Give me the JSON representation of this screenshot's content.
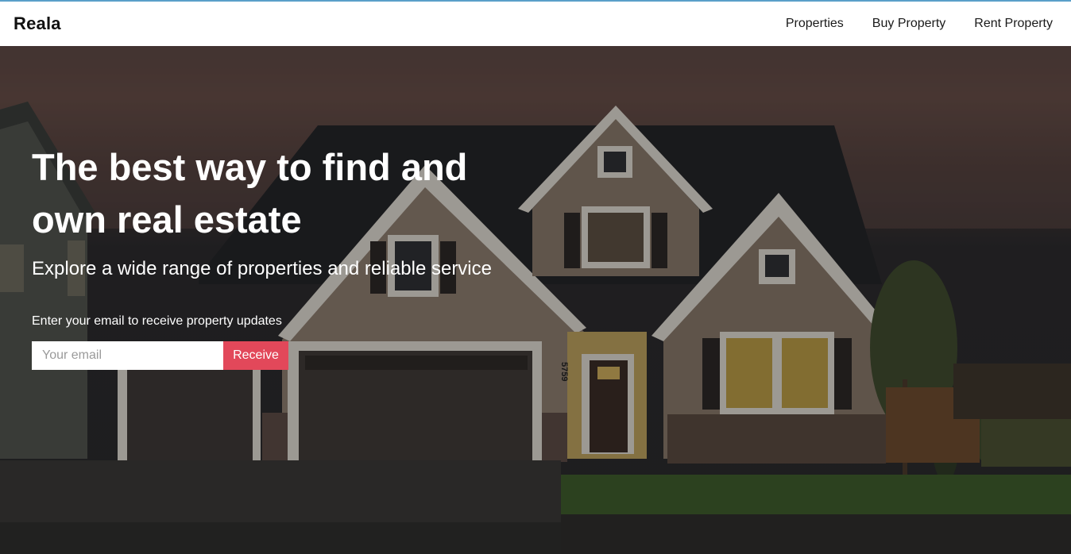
{
  "brand": "Reala",
  "nav": {
    "items": [
      {
        "label": "Properties"
      },
      {
        "label": "Buy Property"
      },
      {
        "label": "Rent Property"
      }
    ]
  },
  "hero": {
    "title": "The best way to find and own real estate",
    "subtitle": "Explore a wide range of properties and reliable service",
    "email_label": "Enter your email to receive property updates",
    "email_placeholder": "Your email",
    "button_label": "Receive",
    "house_number": "5759"
  },
  "colors": {
    "accent": "#e2485a",
    "nav_border": "#5a9fc9"
  }
}
